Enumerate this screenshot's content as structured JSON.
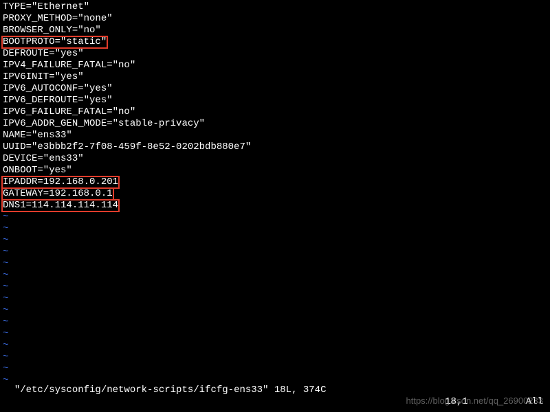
{
  "config": {
    "type": "TYPE=\"Ethernet\"",
    "proxy_method": "PROXY_METHOD=\"none\"",
    "browser_only": "BROWSER_ONLY=\"no\"",
    "bootproto": "BOOTPROTO=\"static\"",
    "defroute": "DEFROUTE=\"yes\"",
    "ipv4_failure_fatal": "IPV4_FAILURE_FATAL=\"no\"",
    "ipv6init": "IPV6INIT=\"yes\"",
    "ipv6_autoconf": "IPV6_AUTOCONF=\"yes\"",
    "ipv6_defroute": "IPV6_DEFROUTE=\"yes\"",
    "ipv6_failure_fatal": "IPV6_FAILURE_FATAL=\"no\"",
    "ipv6_addr_gen_mode": "IPV6_ADDR_GEN_MODE=\"stable-privacy\"",
    "name": "NAME=\"ens33\"",
    "uuid": "UUID=\"e3bbb2f2-7f08-459f-8e52-0202bdb880e7\"",
    "device": "DEVICE=\"ens33\"",
    "onboot": "ONBOOT=\"yes\"",
    "ipaddr": "IPADDR=192.168.0.201",
    "gateway": "GATEWAY=192.168.0.1",
    "dns1": "DNS1=114.114.114.114"
  },
  "tilde": "~",
  "status": {
    "left": "\"/etc/sysconfig/network-scripts/ifcfg-ens33\" 18L, 374C",
    "right_pos": "18,1",
    "right_all": "All"
  },
  "watermark": "https://blog.csdn.net/qq_26900233"
}
